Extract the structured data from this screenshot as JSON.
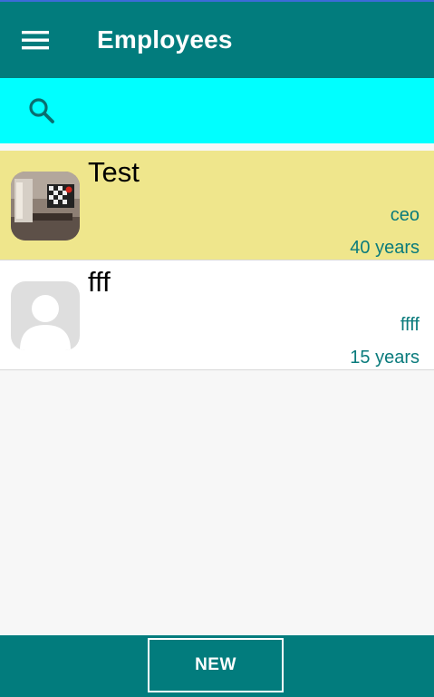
{
  "app_bar": {
    "title": "Employees",
    "menu_icon": "hamburger-menu-icon"
  },
  "search": {
    "icon": "search-icon",
    "value": "",
    "placeholder": ""
  },
  "employees": [
    {
      "name": "Test",
      "role": "ceo",
      "years": "40 years",
      "selected": true,
      "avatar": "room-photo"
    },
    {
      "name": "fff",
      "role": "ffff",
      "years": "15 years",
      "selected": false,
      "avatar": "default-person-icon"
    }
  ],
  "bottom_bar": {
    "new_label": "NEW"
  },
  "colors": {
    "primary": "#027c7d",
    "search_bg": "#00ffff",
    "selected_row": "#efe68c",
    "secondary_text": "#0a7b7c"
  }
}
